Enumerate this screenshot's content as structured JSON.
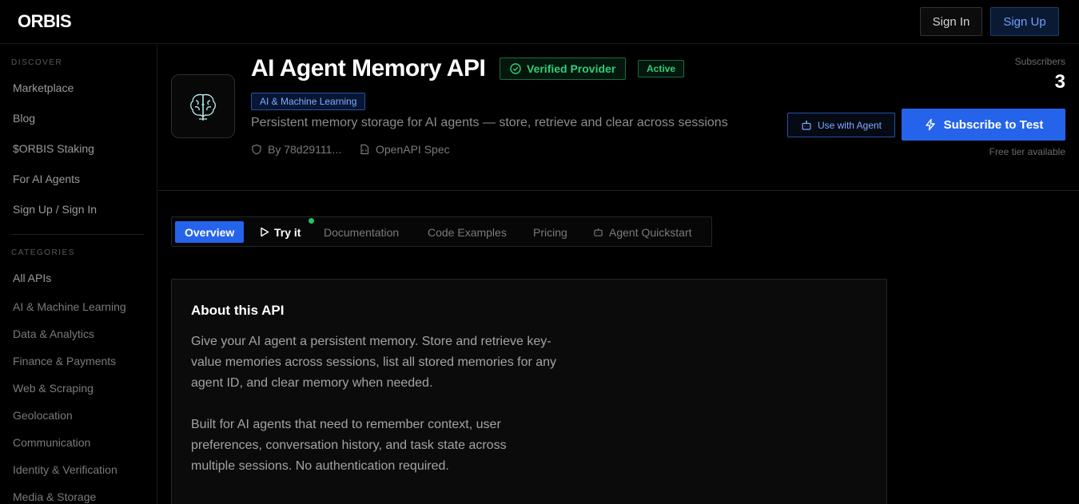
{
  "topbar": {
    "logo": "ORBIS",
    "signin_label": "Sign In",
    "signup_label": "Sign Up"
  },
  "sidebar": {
    "discover_heading": "DISCOVER",
    "discover_items": [
      "Marketplace",
      "Blog",
      "$ORBIS Staking",
      "For AI Agents",
      "Sign Up / Sign In"
    ],
    "categories_heading": "CATEGORIES",
    "categories": [
      "All APIs",
      "AI & Machine Learning",
      "Data & Analytics",
      "Finance & Payments",
      "Web & Scraping",
      "Geolocation",
      "Communication",
      "Identity & Verification",
      "Media & Storage"
    ]
  },
  "api": {
    "title": "AI Agent Memory API",
    "verified_label": "Verified Provider",
    "status_label": "Active",
    "category_tag": "AI & Machine Learning",
    "description": "Persistent memory storage for AI agents — store, retrieve and clear across sessions",
    "author": "By 78d29111...",
    "spec_label": "OpenAPI Spec",
    "subscribers_label": "Subscribers",
    "subscribers_count": "3",
    "use_agent_label": "Use with Agent",
    "subscribe_label": "Subscribe to Test",
    "free_tier_label": "Free tier available"
  },
  "tabs": [
    "Overview",
    "Try it",
    "Documentation",
    "Code Examples",
    "Pricing",
    "Agent Quickstart"
  ],
  "about": {
    "title": "About this API",
    "paragraph1": "Give your AI agent a persistent memory. Store and retrieve key-value memories across sessions, list all stored memories for any agent ID, and clear memory when needed.",
    "paragraph2": "Built for AI agents that need to remember context, user preferences, conversation history, and task state across multiple sessions. No authentication required."
  },
  "colors": {
    "accent": "#2563eb",
    "success": "#2fce7a",
    "background": "#000000"
  },
  "icons": {
    "api_icon": "brain-icon",
    "verified": "check-circle-icon",
    "author": "shield-icon",
    "spec": "document-icon",
    "agent": "robot-icon",
    "subscribe": "lightning-icon",
    "try": "play-icon"
  }
}
